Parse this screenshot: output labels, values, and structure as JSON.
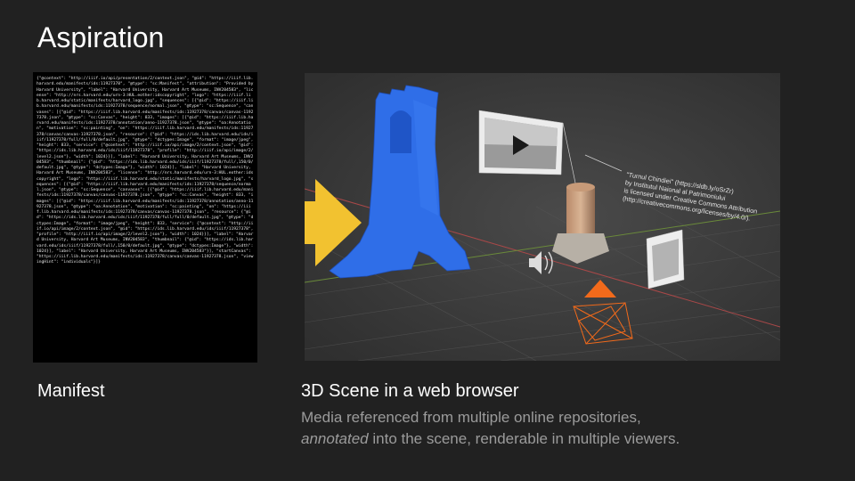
{
  "slide": {
    "title": "Aspiration",
    "manifest_label": "Manifest",
    "scene_label": "3D Scene in a web browser",
    "description_line1": "Media referenced from multiple online repositories,",
    "description_em": "annotated",
    "description_line2_rest": " into the scene, renderable in multiple viewers."
  },
  "manifest_code": "{\"@context\": \"http://iiif.io/api/presentation/2/context.json\", \"@id\": \"https://iiif.lib.harvard.edu/manifests/ids:11927378\", \"@type\": \"sc:Manifest\", \"attribution\": \"Provided by Harvard University\", \"label\": \"Harvard University, Harvard Art Museums, INV204583\", \"license\": \"http://nrs.harvard.edu/urn-3:HUL.eother:idscopyright\", \"logo\": \"https://iiif.lib.harvard.edu/static/manifests/harvard_logo.jpg\", \"sequences\": [{\"@id\": \"https://iiif.lib.harvard.edu/manifests/ids:11927378/sequence/normal.json\", \"@type\": \"sc:Sequence\", \"canvases\": [{\"@id\": \"https://iiif.lib.harvard.edu/manifests/ids:11927378/canvas/canvas-11927378.json\", \"@type\": \"sc:Canvas\", \"height\": 833, \"images\": [{\"@id\": \"https://iiif.lib.harvard.edu/manifests/ids:11927378/annotation/anno-11927378.json\", \"@type\": \"oa:Annotation\", \"motivation\": \"sc:painting\", \"on\": \"https://iiif.lib.harvard.edu/manifests/ids:11927378/canvas/canvas-11927378.json\", \"resource\": {\"@id\": \"https://ids.lib.harvard.edu/ids/iiif/11927378/full/full/0/default.jpg\", \"@type\": \"dctypes:Image\", \"format\": \"image/jpeg\", \"height\": 833, \"service\": {\"@context\": \"http://iiif.io/api/image/2/context.json\", \"@id\": \"https://ids.lib.harvard.edu/ids/iiif/11927378\", \"profile\": \"http://iiif.io/api/image/2/level2.json\"}, \"width\": 1024}}], \"label\": \"Harvard University, Harvard Art Museums, INV204583\", \"thumbnail\": {\"@id\": \"https://ids.lib.harvard.edu/ids/iiif/11927378/full/,150/0/default.jpg\", \"@type\": \"dctypes:Image\"}, \"width\": 1024}], \"label\": \"Harvard University, Harvard Art Museums, INV204583\", \"license\": \"http://nrs.harvard.edu/urn-3:HUL.eother:idscopyright\", \"logo\": \"https://iiif.lib.harvard.edu/static/manifests/harvard_logo.jpg\", \"sequences\": [{\"@id\": \"https://iiif.lib.harvard.edu/manifests/ids:11927378/sequence/normal.json\", \"@type\": \"sc:Sequence\", \"canvases\": [{\"@id\": \"https://iiif.lib.harvard.edu/manifests/ids:11927378/canvas/canvas-11927378.json\", \"@type\": \"sc:Canvas\", \"height\": 833, \"images\": [{\"@id\": \"https://iiif.lib.harvard.edu/manifests/ids:11927378/annotation/anno-11927378.json\", \"@type\": \"oa:Annotation\", \"motivation\": \"sc:painting\", \"on\": \"https://iiif.lib.harvard.edu/manifests/ids:11927378/canvas/canvas-11927378.json\", \"resource\": {\"@id\": \"https://ids.lib.harvard.edu/ids/iiif/11927378/full/full/0/default.jpg\", \"@type\": \"dctypes:Image\", \"format\": \"image/jpeg\", \"height\": 833, \"service\": {\"@context\": \"http://iiif.io/api/image/2/context.json\", \"@id\": \"https://ids.lib.harvard.edu/ids/iiif/11927378\", \"profile\": \"http://iiif.io/api/image/2/level2.json\"}, \"width\": 1024}}], \"label\": \"Harvard University, Harvard Art Museums, INV204583\", \"thumbnail\": {\"@id\": \"https://ids.lib.harvard.edu/ids/iiif/11927378/full/,150/0/default.jpg\", \"@type\": \"dctypes:Image\"}, \"width\": 1024}], \"label\": \"Harvard University, Harvard Art Museums, INV204583\"}], \"startCanvas\": \"https://iiif.lib.harvard.edu/manifests/ids:11927378/canvas/canvas-11927378.json\", \"viewingHint\": \"individuals\"}]}",
  "scene": {
    "annotation_line1": "\"Turnul Chindiei\" (https://sldb.ly/oSrZr)",
    "annotation_line2": "by Institutul Naional al Patrimoniului",
    "annotation_line3": "is licensed under Creative Commons Attribution",
    "annotation_line4": "(http://creativecommons.org/licenses/by/4.0/).",
    "model_color": "#2f6ee8",
    "arrow_color": "#f2c230",
    "camera_marker_color": "#f26a1b"
  },
  "icons": [
    "arrow-right-icon",
    "play-icon",
    "speaker-icon",
    "camera-icon"
  ]
}
